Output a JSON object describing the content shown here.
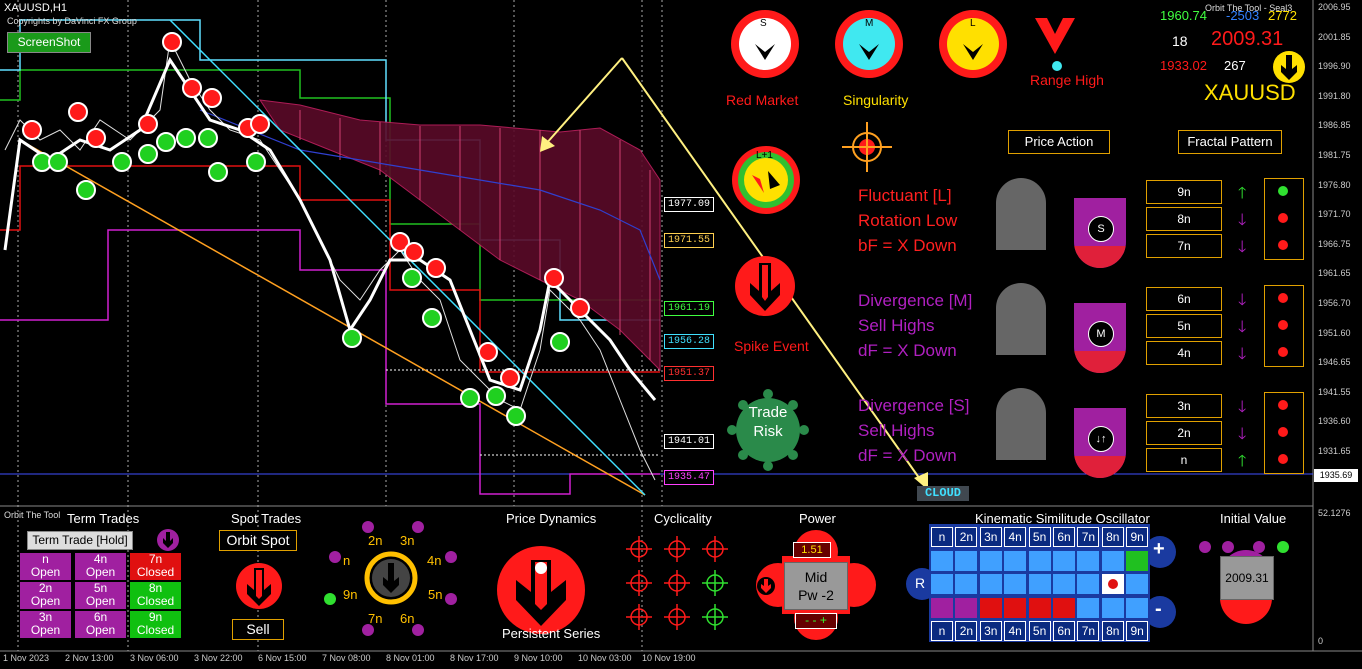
{
  "symbol": {
    "label": "XAUUSD,H1",
    "copyright": "Copyrights by DaVinci FX Group"
  },
  "screenshot_button": "ScreenShot",
  "orbit_tool_top": "Orbit The Tool - Seal3",
  "orbit_tool_bottom": "Orbit The Tool",
  "stats": {
    "high": "1960.74",
    "diff": "-2503",
    "value3": "2772",
    "count": "18",
    "price": "2009.31",
    "low": "1933.02",
    "num2": "267",
    "name": "XAUUSD"
  },
  "signals": {
    "red_market": "Red Market",
    "singularity": "Singularity",
    "range_high": "Range High",
    "spike_event": "Spike Event",
    "trade_risk": "Trade Risk",
    "s_letter": "S",
    "m_letter": "M",
    "l_letter": "L",
    "l1_letter": "L+1"
  },
  "tabs": {
    "price_action": "Price Action",
    "fractal_pattern": "Fractal Pattern"
  },
  "analysis": [
    {
      "lines": [
        "Fluctuant [L]",
        "Rotation Low",
        "bF = X Down"
      ],
      "badge": "S",
      "color": "#ff2020"
    },
    {
      "lines": [
        "Divergence [M]",
        "Sell Highs",
        "dF = X Down"
      ],
      "badge": "M",
      "color": "#b020c0"
    },
    {
      "lines": [
        "Divergence [S]",
        "Sell Highs",
        "dF = X Down"
      ],
      "badge": "↓↑",
      "color": "#b020c0"
    }
  ],
  "fractals": [
    {
      "label": "9n",
      "arrow": "up"
    },
    {
      "label": "8n",
      "arrow": "down"
    },
    {
      "label": "7n",
      "arrow": "down"
    },
    {
      "label": "6n",
      "arrow": "down"
    },
    {
      "label": "5n",
      "arrow": "down"
    },
    {
      "label": "4n",
      "arrow": "down"
    },
    {
      "label": "3n",
      "arrow": "down"
    },
    {
      "label": "2n",
      "arrow": "down"
    },
    {
      "label": "n",
      "arrow": "up"
    }
  ],
  "fractal_dots": [
    [
      "green",
      "red",
      "red"
    ],
    [
      "red",
      "red",
      "red"
    ],
    [
      "red",
      "red",
      "red"
    ]
  ],
  "price_labels": [
    {
      "text": "1977.09",
      "color": "#ffffff"
    },
    {
      "text": "1971.55",
      "color": "#ffd050"
    },
    {
      "text": "1961.19",
      "color": "#40ff40"
    },
    {
      "text": "1956.28",
      "color": "#40e0ff"
    },
    {
      "text": "1951.37",
      "color": "#ff3030"
    },
    {
      "text": "1941.01",
      "color": "#ffffff"
    },
    {
      "text": "1935.47",
      "color": "#ff40ff"
    }
  ],
  "axis_prices": [
    "2006.95",
    "2001.85",
    "1996.90",
    "1991.80",
    "1986.85",
    "1981.75",
    "1976.80",
    "1971.70",
    "1966.75",
    "1961.65",
    "1956.70",
    "1951.60",
    "1946.65",
    "1941.55",
    "1936.60",
    "1931.65"
  ],
  "current_price": "1935.69",
  "axis_bottom": [
    "52.1276",
    "0"
  ],
  "dates": [
    "1 Nov 2023",
    "2 Nov 13:00",
    "3 Nov 06:00",
    "3 Nov 22:00",
    "6 Nov 15:00",
    "7 Nov 08:00",
    "8 Nov 01:00",
    "8 Nov 17:00",
    "9 Nov 10:00",
    "10 Nov 03:00",
    "10 Nov 19:00"
  ],
  "cloud_label": "CLOUD",
  "bottom": {
    "term_trades": "Term Trades",
    "term_button": "Term Trade [Hold]",
    "term_grid": [
      [
        {
          "t": "n\nOpen",
          "c": "#a020a0"
        },
        {
          "t": "4n\nOpen",
          "c": "#a020a0"
        },
        {
          "t": "7n\nClosed",
          "c": "#e01010"
        }
      ],
      [
        {
          "t": "2n\nOpen",
          "c": "#a020a0"
        },
        {
          "t": "5n\nOpen",
          "c": "#a020a0"
        },
        {
          "t": "8n\nClosed",
          "c": "#10c010"
        }
      ],
      [
        {
          "t": "3n\nOpen",
          "c": "#a020a0"
        },
        {
          "t": "6n\nOpen",
          "c": "#a020a0"
        },
        {
          "t": "9n\nClosed",
          "c": "#10c010"
        }
      ]
    ],
    "spot_trades": "Spot Trades",
    "orbit_spot": "Orbit Spot",
    "sell": "Sell",
    "orbit_labels": [
      "2n",
      "3n",
      "n",
      "4n",
      "9n",
      "5n",
      "7n",
      "6n"
    ],
    "price_dynamics": "Price Dynamics",
    "persistent_series": "Persistent Series",
    "cyclicality": "Cyclicality",
    "power": "Power",
    "power_value": "1.51",
    "power_mid": "Mid",
    "power_pw": "Pw -2",
    "power_sign": "- - +",
    "kso_title": "Kinematic Similitude Oscillator",
    "kso_labels": [
      "n",
      "2n",
      "3n",
      "4n",
      "5n",
      "6n",
      "7n",
      "8n",
      "9n"
    ],
    "kso_r": "R",
    "kso_plus": "+",
    "kso_minus": "-",
    "initial_value": "Initial Value",
    "initial_price": "2009.31"
  },
  "colors": {
    "accent": "#e0a000",
    "red": "#ff1a1a",
    "purple": "#a020a0",
    "green": "#20c020",
    "cyan": "#40e0ff",
    "yellow": "#ffe000"
  }
}
